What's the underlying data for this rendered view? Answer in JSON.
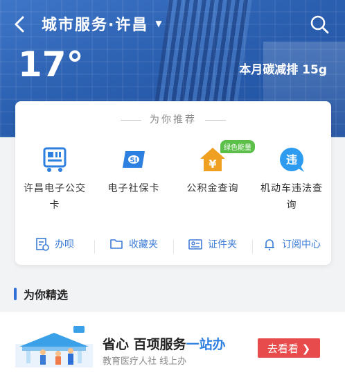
{
  "header": {
    "title": "城市服务·许昌",
    "caret": "▼",
    "temperature": "17°",
    "carbon": "本月碳减排 15g"
  },
  "recommend": {
    "title": "为你推荐",
    "badge": "绿色能量",
    "items": [
      {
        "label": "许昌电子公交卡",
        "icon": "bus-card-icon",
        "color": "#2d7fe0"
      },
      {
        "label": "电子社保卡",
        "icon": "social-security-card-icon",
        "color": "#2d7fe0"
      },
      {
        "label": "公积金查询",
        "icon": "housing-fund-icon",
        "color": "#f0a020"
      },
      {
        "label": "机动车违法查询",
        "icon": "traffic-violation-icon",
        "color": "#2d9cf0"
      }
    ]
  },
  "quick_links": [
    {
      "label": "办呗",
      "icon": "task-icon"
    },
    {
      "label": "收藏夹",
      "icon": "folder-icon"
    },
    {
      "label": "证件夹",
      "icon": "id-card-icon"
    },
    {
      "label": "订阅中心",
      "icon": "bell-icon"
    }
  ],
  "featured": {
    "section_title": "为你精选",
    "headline_prefix": "省心 百项服务",
    "headline_accent": "一站办",
    "subtext": "教育医疗人社 线上办",
    "button_label": "去看看 ❯"
  }
}
